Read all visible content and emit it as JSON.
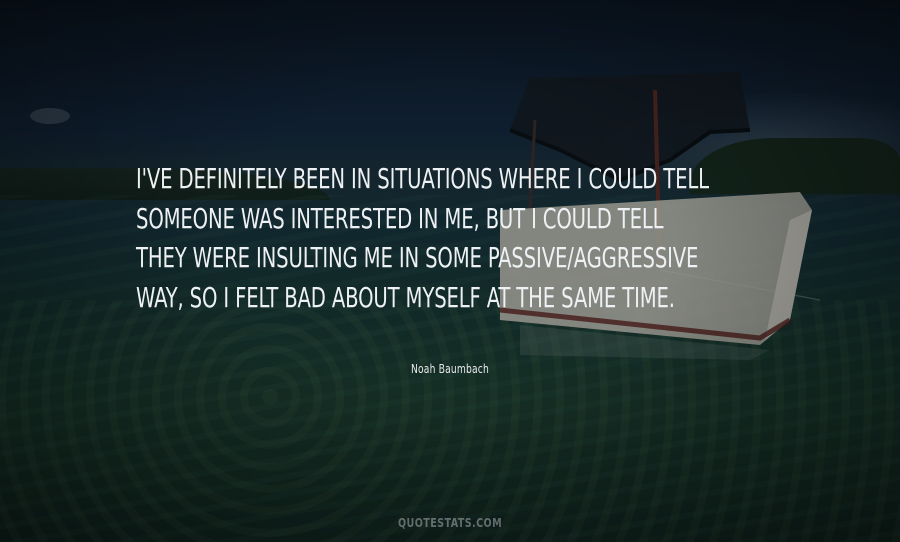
{
  "quote": {
    "lines": [
      "I've definitely been in situations where I could tell",
      "someone was interested in me, but I could tell",
      "they were insulting me in some passive/aggressive",
      "way, so I felt bad about myself at the same time."
    ]
  },
  "author": "Noah Baumbach",
  "watermark": "QUOTESTATS.COM"
}
